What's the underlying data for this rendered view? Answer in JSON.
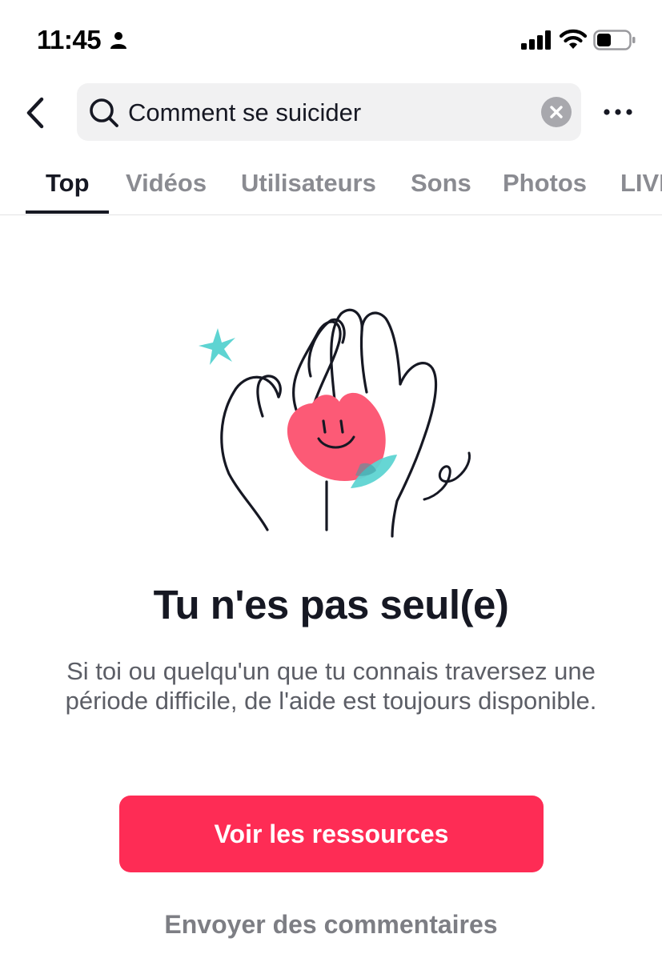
{
  "status_bar": {
    "time": "11:45",
    "icons": [
      "person-icon",
      "cellular-signal-icon",
      "wifi-icon",
      "battery-icon"
    ]
  },
  "header": {
    "back_icon": "chevron-left-icon",
    "search": {
      "icon": "search-icon",
      "value": "Comment se suicider",
      "clear_icon": "clear-x-icon"
    },
    "more_icon": "more-dots-icon"
  },
  "tabs": [
    {
      "label": "Top",
      "active": true
    },
    {
      "label": "Vidéos",
      "active": false
    },
    {
      "label": "Utilisateurs",
      "active": false
    },
    {
      "label": "Sons",
      "active": false
    },
    {
      "label": "Photos",
      "active": false
    },
    {
      "label": "LIVE",
      "active": false
    }
  ],
  "content": {
    "illustration": "hands-holding-flower-illustration",
    "headline": "Tu n'es pas seul(e)",
    "description": "Si toi ou quelqu'un que tu connais traversez une période difficile, de l'aide est toujours disponible.",
    "primary_button": "Voir les ressources",
    "secondary_link": "Envoyer des commentaires"
  },
  "colors": {
    "accent": "#fe2c55",
    "text_primary": "#161823",
    "text_secondary": "#5c5e66",
    "tab_inactive": "#8a8b91",
    "search_bg": "#f1f1f2",
    "leaf": "#5ed4d2"
  }
}
